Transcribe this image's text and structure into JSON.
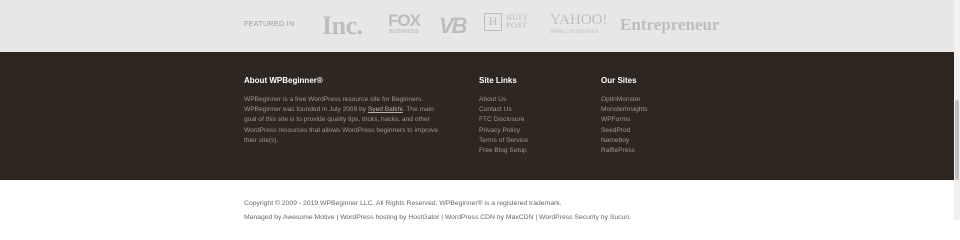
{
  "featured": {
    "label": "FEATURED IN",
    "logos": {
      "inc": "Inc.",
      "fox_top": "FOX",
      "fox_bottom": "BUSINESS",
      "vb": "VB",
      "huff_box": "H",
      "huff_line1": "HUFF",
      "huff_line2": "POST",
      "yahoo_top": "YAHOO!",
      "yahoo_bottom": "SMALL BUSINESS",
      "entrepreneur": "Entrepreneur"
    }
  },
  "footer": {
    "about": {
      "title": "About WPBeginner®",
      "text_before": "WPBeginner is a free WordPress resource site for Beginners. WPBeginner was founded in July 2009 by ",
      "link": "Syed Balkhi",
      "text_after": ". The main goal of this site is to provide quality tips, tricks, hacks, and other WordPress resources that allows WordPress beginners to improve their site(s)."
    },
    "site_links": {
      "title": "Site Links",
      "items": [
        "About Us",
        "Contact Us",
        "FTC Disclosure",
        "Privacy Policy",
        "Terms of Service",
        "Free Blog Setup"
      ]
    },
    "our_sites": {
      "title": "Our Sites",
      "items": [
        "OptinMonster",
        "MonsterInsights",
        "WPForms",
        "SeedProd",
        "Nameboy",
        "RafflePress"
      ]
    }
  },
  "bottom": {
    "copyright": "Copyright © 2009 - 2019 WPBeginner LLC. All Rights Reserved. WPBeginner® is a registered trademark.",
    "managed": "Managed by Awesome Motive | WordPress hosting by HostGator | WordPress CDN by MaxCDN | WordPress Security by Sucuri."
  }
}
